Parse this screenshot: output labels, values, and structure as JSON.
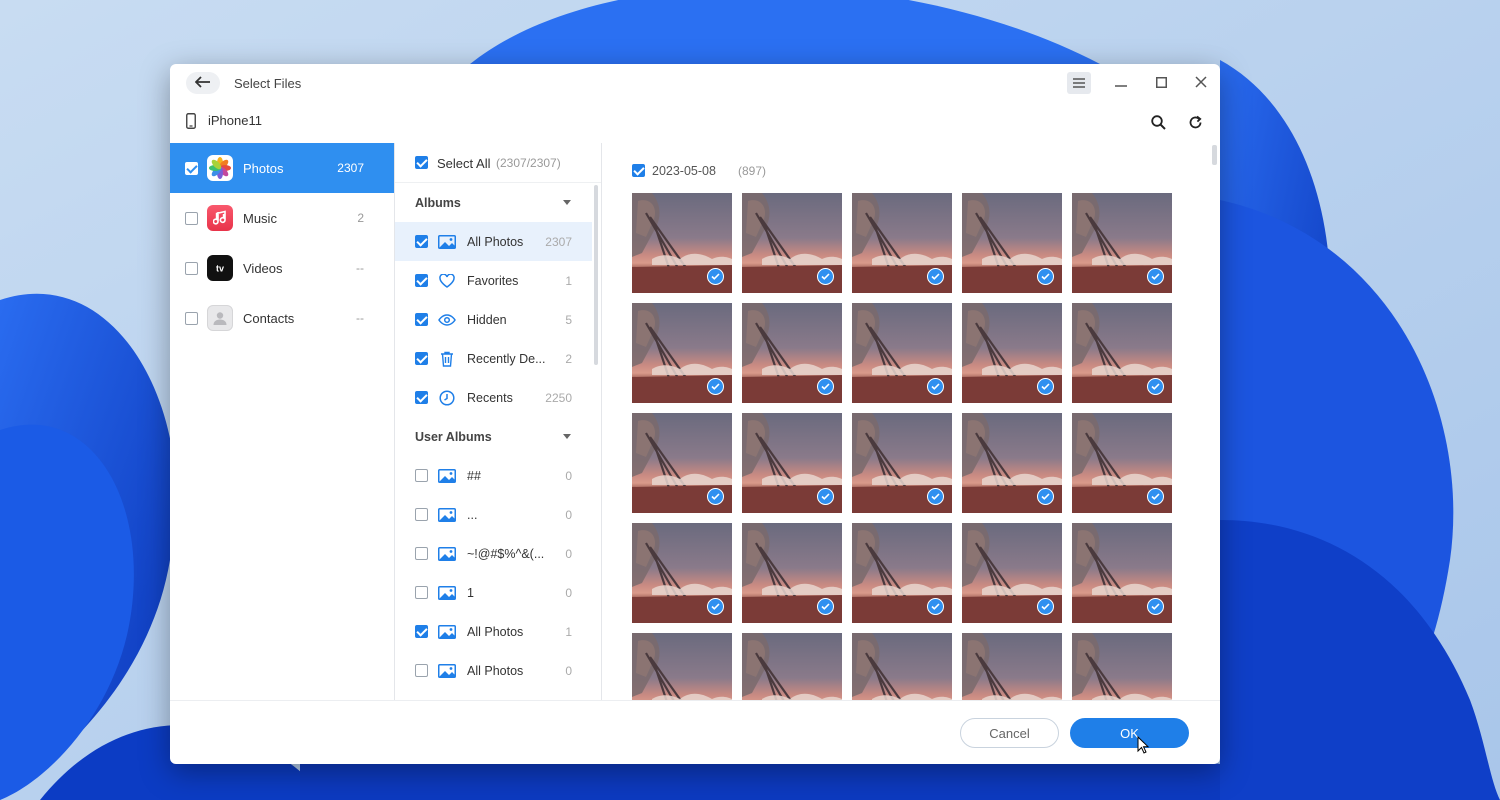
{
  "colors": {
    "accent": "#1f7fe8",
    "selected_category": "#2f8ff0",
    "wallpaper_blue": "#1c4fd8"
  },
  "titlebar": {
    "title": "Select Files",
    "back_icon": "arrow-left-icon",
    "menu_icon": "hamburger-menu-icon",
    "minimize_icon": "minimize-icon",
    "maximize_icon": "maximize-icon",
    "close_icon": "close-icon"
  },
  "device": {
    "name": "iPhone11",
    "icon": "phone-icon",
    "search_icon": "search-icon",
    "refresh_icon": "refresh-icon"
  },
  "categories": [
    {
      "label": "Photos",
      "count": "2307",
      "checked": true,
      "selected": true,
      "icon": "photos-app-icon"
    },
    {
      "label": "Music",
      "count": "2",
      "checked": false,
      "selected": false,
      "icon": "music-app-icon"
    },
    {
      "label": "Videos",
      "count": "--",
      "checked": false,
      "selected": false,
      "icon": "appletv-app-icon"
    },
    {
      "label": "Contacts",
      "count": "--",
      "checked": false,
      "selected": false,
      "icon": "contacts-app-icon"
    }
  ],
  "select_all": {
    "label": "Select All",
    "count": "(2307/2307)",
    "checked": true
  },
  "albums": {
    "header": "Albums",
    "items": [
      {
        "label": "All Photos",
        "count": "2307",
        "checked": true,
        "icon": "image-icon",
        "active": true
      },
      {
        "label": "Favorites",
        "count": "1",
        "checked": true,
        "icon": "heart-icon",
        "active": false
      },
      {
        "label": "Hidden",
        "count": "5",
        "checked": true,
        "icon": "eye-icon",
        "active": false
      },
      {
        "label": "Recently De...",
        "count": "2",
        "checked": true,
        "icon": "trash-icon",
        "active": false
      },
      {
        "label": "Recents",
        "count": "2250",
        "checked": true,
        "icon": "clock-icon",
        "active": false
      }
    ]
  },
  "user_albums": {
    "header": "User Albums",
    "items": [
      {
        "label": "##",
        "count": "0",
        "checked": false,
        "icon": "image-icon"
      },
      {
        "label": "...",
        "count": "0",
        "checked": false,
        "icon": "image-icon"
      },
      {
        "label": "~!@#$%^&(...",
        "count": "0",
        "checked": false,
        "icon": "image-icon"
      },
      {
        "label": "1",
        "count": "0",
        "checked": false,
        "icon": "image-icon"
      },
      {
        "label": "All Photos",
        "count": "1",
        "checked": true,
        "icon": "image-icon"
      },
      {
        "label": "All Photos",
        "count": "0",
        "checked": false,
        "icon": "image-icon"
      }
    ]
  },
  "photo_group": {
    "date": "2023-05-08",
    "count": "(897)",
    "checked": true,
    "visible_rows": 5,
    "columns": 5
  },
  "footer": {
    "cancel_label": "Cancel",
    "ok_label": "OK"
  }
}
